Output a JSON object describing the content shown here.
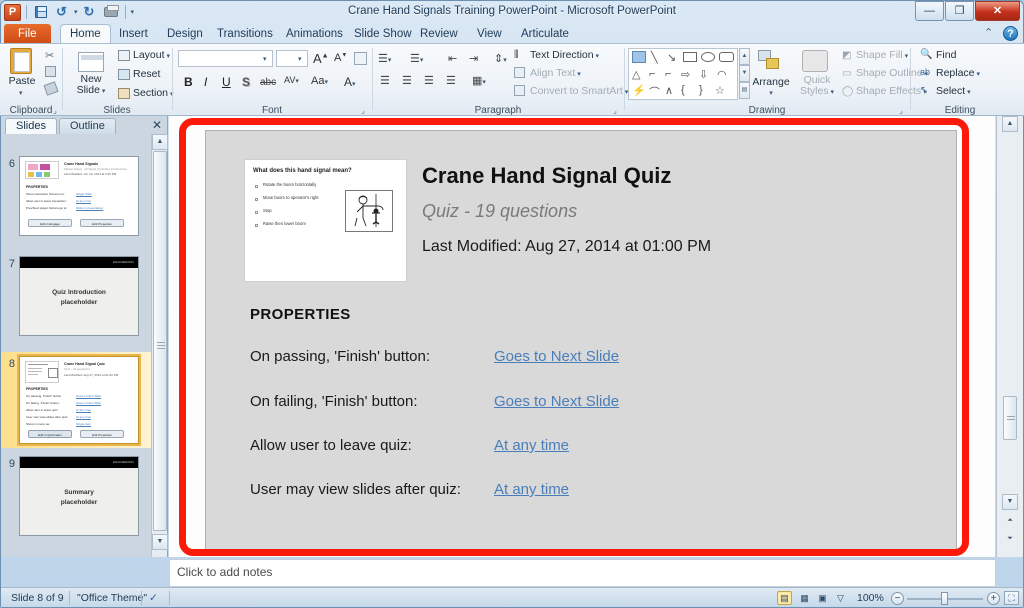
{
  "window": {
    "title": "Crane Hand Signals Training PowerPoint - Microsoft PowerPoint",
    "minimize": "—",
    "maximize": "❐",
    "close": "✕"
  },
  "quick_access": {
    "app_logo": "P",
    "save": "save-icon",
    "undo": "↺",
    "redo": "↻",
    "print_preview": "print-icon",
    "customize": "▾"
  },
  "ribbon": {
    "tabs": [
      {
        "label": "File",
        "active": false,
        "file": true
      },
      {
        "label": "Home",
        "active": true
      },
      {
        "label": "Insert",
        "active": false
      },
      {
        "label": "Design",
        "active": false
      },
      {
        "label": "Transitions",
        "active": false
      },
      {
        "label": "Animations",
        "active": false
      },
      {
        "label": "Slide Show",
        "active": false
      },
      {
        "label": "Review",
        "active": false
      },
      {
        "label": "View",
        "active": false
      },
      {
        "label": "Articulate",
        "active": false
      }
    ],
    "minimize_ribbon": "⌃",
    "help": "?",
    "groups": {
      "clipboard": {
        "label": "Clipboard",
        "paste": "Paste",
        "paste_caret": "▾",
        "cut": "✂",
        "copy": "copy-icon",
        "format_painter": "format-painter-icon"
      },
      "slides": {
        "label": "Slides",
        "new_slide": "New\nSlide",
        "new_slide_line1": "New",
        "new_slide_line2": "Slide",
        "layout": "Layout",
        "reset": "Reset",
        "section": "Section"
      },
      "font": {
        "label": "Font",
        "font_name_value": "",
        "font_name_placeholder": "",
        "font_size_value": "",
        "grow_font": "A",
        "shrink_font": "A",
        "clear_formatting": "clear-format-icon",
        "bold": "B",
        "italic": "I",
        "underline": "U",
        "shadow": "S",
        "strikethrough": "abc",
        "character_spacing": "AV",
        "change_case": "Aa",
        "font_color": "A"
      },
      "paragraph": {
        "label": "Paragraph",
        "bullets": "bullets-icon",
        "numbering": "numbering-icon",
        "decrease_indent": "decrease-indent-icon",
        "increase_indent": "increase-indent-icon",
        "line_spacing": "line-spacing-icon",
        "align_left": "align-left-icon",
        "align_center": "align-center-icon",
        "align_right": "align-right-icon",
        "justify": "justify-icon",
        "columns": "columns-icon",
        "text_direction": "Text Direction",
        "align_text": "Align Text",
        "convert_to_smartart": "Convert to SmartArt"
      },
      "drawing": {
        "label": "Drawing",
        "arrange": "Arrange",
        "quick_styles_line1": "Quick",
        "quick_styles_line2": "Styles",
        "shape_fill": "Shape Fill",
        "shape_outline": "Shape Outline",
        "shape_effects": "Shape Effects"
      },
      "editing": {
        "label": "Editing",
        "find": "Find",
        "replace": "Replace",
        "select": "Select"
      }
    }
  },
  "slides_pane": {
    "tabs": [
      {
        "label": "Slides",
        "selected": true
      },
      {
        "label": "Outline",
        "selected": false
      }
    ],
    "close": "✕",
    "thumbnails": [
      {
        "number": "6",
        "selected": false,
        "kind": "properties",
        "title": "Crane Hand Signals",
        "subtitle": "Master Panel - 19 Steps (including introduction)",
        "modified": "Last Modified: Jun 12, 2014 at 3:45 PM",
        "section": "PROPERTIES",
        "rows": [
          {
            "label": "Show interactive Screens on:",
            "value": "Single Slide"
          },
          {
            "label": "Allow user to leave interaction:",
            "value": "At any time"
          },
          {
            "label": "Prev/Next player buttons go to:",
            "value": "Slide in presentation"
          }
        ],
        "buttons": [
          "Edit in Engage",
          "Edit Properties"
        ]
      },
      {
        "number": "7",
        "selected": false,
        "kind": "placeholder",
        "text_line1": "Quiz Introduction",
        "text_line2": "placeholder",
        "banner_label": "ENGINEERING"
      },
      {
        "number": "8",
        "selected": true,
        "kind": "quiz-properties",
        "title": "Crane Hand Signal Quiz",
        "subtitle": "Quiz - 19 questions",
        "modified": "Last Modified: Aug 27, 2014 at 01:00 PM",
        "section": "PROPERTIES",
        "rows": [
          {
            "label": "On passing, 'Finish' button:",
            "value": "Goes to Next Slide"
          },
          {
            "label": "On failing, 'Finish' button:",
            "value": "Goes to Next Slide"
          },
          {
            "label": "Allow user to leave quiz:",
            "value": "At any time"
          },
          {
            "label": "User may view slides after quiz:",
            "value": "At any time"
          },
          {
            "label": "Show in menu as:",
            "value": "Single Item"
          }
        ],
        "buttons": [
          "Edit in Quizmaker",
          "Edit Properties"
        ]
      },
      {
        "number": "9",
        "selected": false,
        "kind": "placeholder",
        "text_line1": "Summary",
        "text_line2": "placeholder",
        "banner_label": "ENGINEERING"
      }
    ]
  },
  "slide": {
    "preview": {
      "question": "What does this hand signal mean?",
      "choices": [
        "Rotate the boom horizontally",
        "Move boom to operator's right",
        "Stop",
        "Raise then lower boom"
      ]
    },
    "title": "Crane Hand Signal Quiz",
    "subtitle": "Quiz - 19 questions",
    "modified": "Last Modified: Aug 27, 2014 at 01:00 PM",
    "properties_heading": "PROPERTIES",
    "properties": [
      {
        "label": "On passing, 'Finish' button:",
        "value": "Goes to Next Slide"
      },
      {
        "label": "On failing, 'Finish' button:",
        "value": "Goes to Next Slide"
      },
      {
        "label": "Allow user to leave quiz:",
        "value": "At any time"
      },
      {
        "label": "User may view slides after quiz:",
        "value": "At any time"
      }
    ]
  },
  "notes": {
    "placeholder": "Click to add notes"
  },
  "status_bar": {
    "slide_indicator": "Slide 8 of 9",
    "theme": "\"Office Theme\"",
    "spellcheck": "spellcheck-icon",
    "views": [
      {
        "name": "normal-view",
        "glyph": "▤",
        "selected": true
      },
      {
        "name": "slide-sorter-view",
        "glyph": "▦",
        "selected": false
      },
      {
        "name": "reading-view",
        "glyph": "▣",
        "selected": false
      },
      {
        "name": "slide-show-view",
        "glyph": "▽",
        "selected": false
      }
    ],
    "zoom_level": "100%",
    "zoom_out": "−",
    "zoom_in": "+",
    "fit_to_window": "⛶"
  },
  "scrollbars": {
    "up_arrow": "▲",
    "down_arrow": "▼",
    "prev_slide": "⏶",
    "next_slide": "⏷"
  },
  "colors": {
    "annotation": "#fb1a09",
    "link": "#4a7ebb",
    "file_tab": "#cd4a15",
    "selection": "#e8b64b"
  }
}
